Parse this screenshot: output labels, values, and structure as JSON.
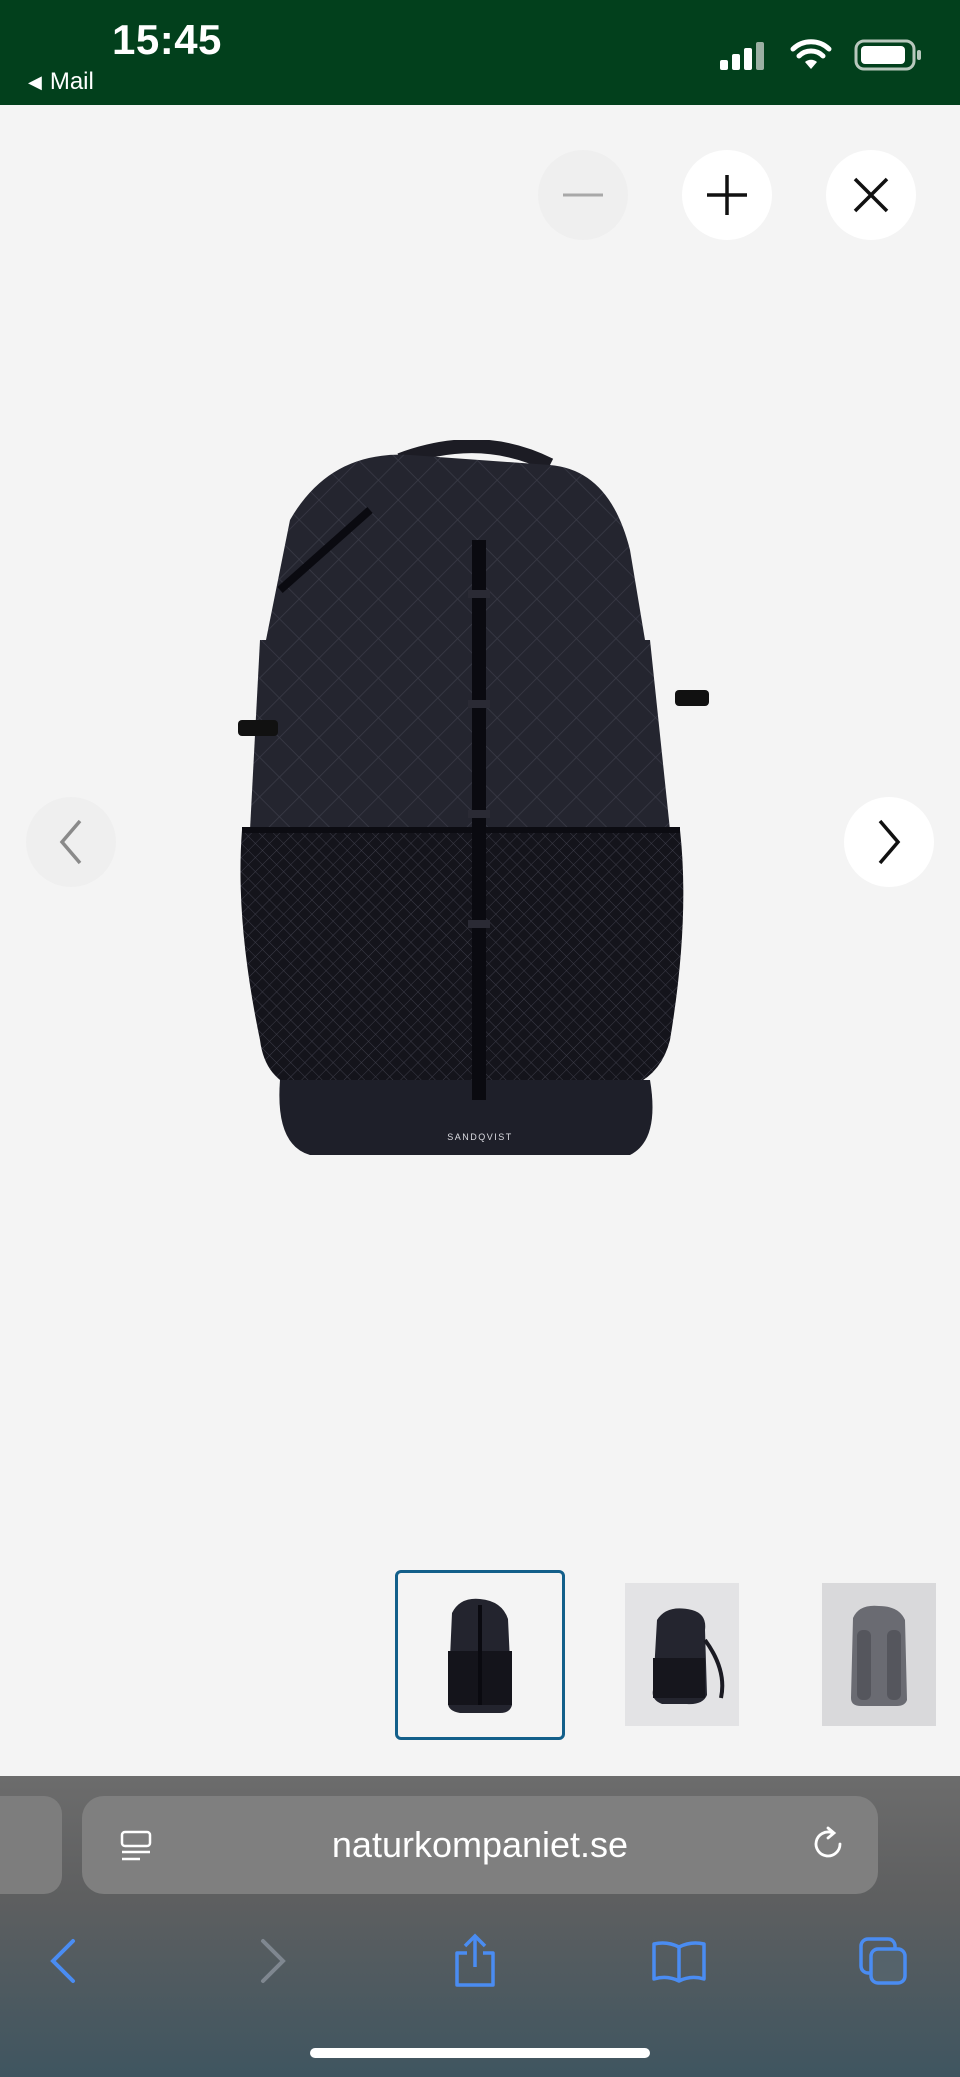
{
  "status_bar": {
    "time": "15:45",
    "back_app": "Mail",
    "icons": [
      "cellular-signal-icon",
      "wifi-icon",
      "battery-icon"
    ]
  },
  "viewer": {
    "controls": [
      "zoom-out-icon",
      "zoom-in-icon",
      "close-icon"
    ],
    "nav": [
      "chevron-left-icon",
      "chevron-right-icon"
    ],
    "product_brand_text": "SANDQVIST",
    "thumbnails": [
      {
        "label": "front",
        "selected": true
      },
      {
        "label": "side",
        "selected": false
      },
      {
        "label": "back",
        "selected": false
      }
    ],
    "selected_border_color": "#135f8a"
  },
  "browser": {
    "url": "naturkompaniet.se",
    "toolbar_icons": [
      "back-icon",
      "forward-icon",
      "share-icon",
      "bookmarks-icon",
      "tabs-icon"
    ]
  },
  "colors": {
    "status_bar_bg": "#02401c",
    "page_bg": "#f4f4f4",
    "accent_blue": "#4a8cf2"
  }
}
